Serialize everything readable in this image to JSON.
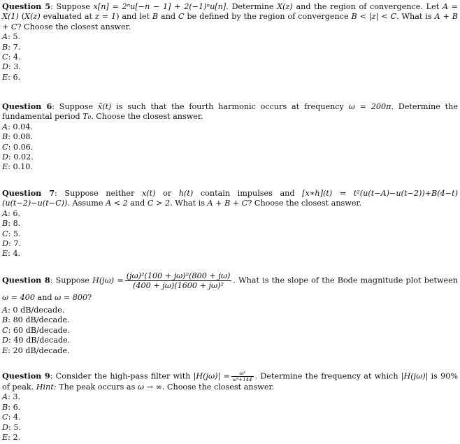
{
  "questions": [
    {
      "label": "Question 5",
      "stem_part1": ": Suppose ",
      "math1": "x[n] = 2ⁿu[−n − 1] + 2(−1)ⁿu[n]",
      "stem_part2": ". Determine ",
      "math2": "X(z)",
      "stem_part3": " and the region of convergence. Let ",
      "math3": "A = X(1)",
      "stem_part4": " (",
      "math4": "X(z)",
      "stem_part5": " evaluated at ",
      "math5": "z = 1",
      "stem_part6": ") and let ",
      "math6": "B",
      "stem_part7": " and ",
      "math7": "C",
      "stem_part8": " be defined by the region of convergence ",
      "math8": "B < |z| < C",
      "stem_part9": ". What is ",
      "math9": "A + B + C",
      "stem_part10": "? Choose the closest answer.",
      "options": [
        {
          "letter": "A",
          "value": "5."
        },
        {
          "letter": "B",
          "value": "7."
        },
        {
          "letter": "C",
          "value": "4."
        },
        {
          "letter": "D",
          "value": "3."
        },
        {
          "letter": "E",
          "value": "6."
        }
      ]
    },
    {
      "label": "Question 6",
      "stem_part1": ": Suppose ",
      "math1": "x̃(t)",
      "stem_part2": " is such that the fourth harmonic occurs at frequency ",
      "math2": "ω = 200π",
      "stem_part3": ". Determine the fundamental period ",
      "math3": "T₀",
      "stem_part4": ". Choose the closest answer.",
      "options": [
        {
          "letter": "A",
          "value": "0.04."
        },
        {
          "letter": "B",
          "value": "0.08."
        },
        {
          "letter": "C",
          "value": "0.06."
        },
        {
          "letter": "D",
          "value": "0.02."
        },
        {
          "letter": "E",
          "value": "0.10."
        }
      ]
    },
    {
      "label": "Question 7",
      "stem_part1": ": Suppose neither ",
      "math1": "x(t)",
      "stem_part2": " or ",
      "math2": "h(t)",
      "stem_part3": " contain impulses and ",
      "math3": "[x∗h](t) = t²(u(t−A)−u(t−2))+B(4−t)(u(t−2)−u(t−C))",
      "stem_part4": ". Assume ",
      "math4": "A < 2",
      "stem_part5": " and ",
      "math5": "C > 2",
      "stem_part6": ". What is ",
      "math6": "A + B + C",
      "stem_part7": "? Choose the closest answer.",
      "options": [
        {
          "letter": "A",
          "value": "6."
        },
        {
          "letter": "B",
          "value": "8."
        },
        {
          "letter": "C",
          "value": "5."
        },
        {
          "letter": "D",
          "value": "7."
        },
        {
          "letter": "E",
          "value": "4."
        }
      ]
    },
    {
      "label": "Question 8",
      "stem_part1": ": Suppose ",
      "math1": "H(jω) =",
      "frac_num": "(jω)²(100 + jω)²(800 + jω)",
      "frac_den": "(400 + jω)(1600 + jω)²",
      "stem_part2": ". What is the slope of the Bode magnitude plot between ",
      "math2": "ω = 400",
      "stem_part3": " and ",
      "math3": "ω = 800",
      "stem_part4": "?",
      "options": [
        {
          "letter": "A",
          "value": "0 dB/decade."
        },
        {
          "letter": "B",
          "value": "80 dB/decade."
        },
        {
          "letter": "C",
          "value": "60 dB/decade."
        },
        {
          "letter": "D",
          "value": "40 dB/decade."
        },
        {
          "letter": "E",
          "value": "20 dB/decade."
        }
      ]
    },
    {
      "label": "Question 9",
      "stem_part1": ": Consider the high-pass filter with ",
      "math1": "|H(jω)| =",
      "frac_num": "ω⁴",
      "frac_den": "ω⁴+144",
      "stem_part2": ". Determine the frequency at which ",
      "math2": "|H(jω)|",
      "stem_part3": " is 90% of peak. ",
      "hint_label": "Hint:",
      "stem_part4": " The peak occurs as ",
      "math3": "ω → ∞",
      "stem_part5": ". Choose the closest answer.",
      "options": [
        {
          "letter": "A",
          "value": "3."
        },
        {
          "letter": "B",
          "value": "6."
        },
        {
          "letter": "C",
          "value": "4."
        },
        {
          "letter": "D",
          "value": "5."
        },
        {
          "letter": "E",
          "value": "2."
        }
      ]
    }
  ]
}
